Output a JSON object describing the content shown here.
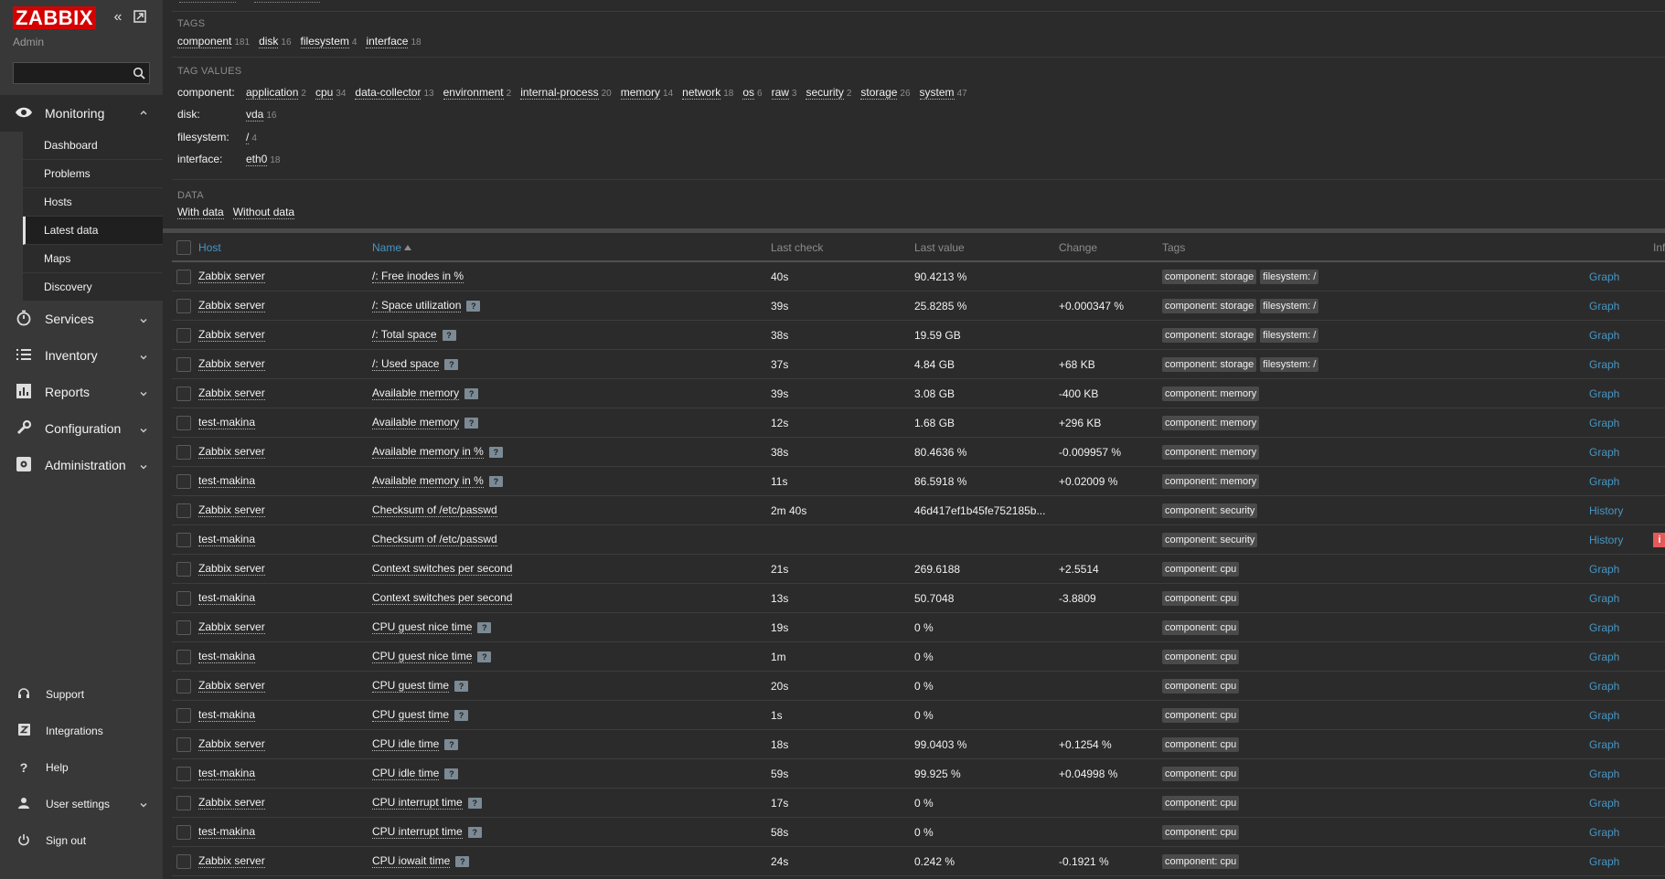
{
  "brand": {
    "logo": "ZABBIX",
    "user": "Admin"
  },
  "sidebar": {
    "search_placeholder": "",
    "monitoring": {
      "label": "Monitoring",
      "items": [
        "Dashboard",
        "Problems",
        "Hosts",
        "Latest data",
        "Maps",
        "Discovery"
      ],
      "active": "Latest data"
    },
    "menus": [
      "Services",
      "Inventory",
      "Reports",
      "Configuration",
      "Administration"
    ],
    "bottom": [
      "Support",
      "Integrations",
      "Help",
      "User settings",
      "Sign out"
    ]
  },
  "filter": {
    "tags_heading": "TAGS",
    "tags": [
      {
        "name": "component",
        "count": "181"
      },
      {
        "name": "disk",
        "count": "16"
      },
      {
        "name": "filesystem",
        "count": "4"
      },
      {
        "name": "interface",
        "count": "18"
      }
    ],
    "tag_values_heading": "TAG VALUES",
    "tag_values": [
      {
        "label": "component:",
        "values": [
          {
            "name": "application",
            "count": "2"
          },
          {
            "name": "cpu",
            "count": "34"
          },
          {
            "name": "data-collector",
            "count": "13"
          },
          {
            "name": "environment",
            "count": "2"
          },
          {
            "name": "internal-process",
            "count": "20"
          },
          {
            "name": "memory",
            "count": "14"
          },
          {
            "name": "network",
            "count": "18"
          },
          {
            "name": "os",
            "count": "6"
          },
          {
            "name": "raw",
            "count": "3"
          },
          {
            "name": "security",
            "count": "2"
          },
          {
            "name": "storage",
            "count": "26"
          },
          {
            "name": "system",
            "count": "47"
          }
        ]
      },
      {
        "label": "disk:",
        "values": [
          {
            "name": "vda",
            "count": "16"
          }
        ]
      },
      {
        "label": "filesystem:",
        "values": [
          {
            "name": "/",
            "count": "4"
          }
        ]
      },
      {
        "label": "interface:",
        "values": [
          {
            "name": "eth0",
            "count": "18"
          }
        ]
      }
    ],
    "data_heading": "DATA",
    "data_links": [
      "With data",
      "Without data"
    ]
  },
  "table": {
    "headers": {
      "host": "Host",
      "name": "Name",
      "last_check": "Last check",
      "last_value": "Last value",
      "change": "Change",
      "tags": "Tags",
      "info": "Info"
    },
    "rows": [
      {
        "host": "Zabbix server",
        "name": "/: Free inodes in %",
        "hint": false,
        "check": "40s",
        "value": "90.4213 %",
        "change": "",
        "tags": [
          "component: storage",
          "filesystem: /"
        ],
        "action": "Graph",
        "info": false
      },
      {
        "host": "Zabbix server",
        "name": "/: Space utilization",
        "hint": true,
        "check": "39s",
        "value": "25.8285 %",
        "change": "+0.000347 %",
        "tags": [
          "component: storage",
          "filesystem: /"
        ],
        "action": "Graph",
        "info": false
      },
      {
        "host": "Zabbix server",
        "name": "/: Total space",
        "hint": true,
        "check": "38s",
        "value": "19.59 GB",
        "change": "",
        "tags": [
          "component: storage",
          "filesystem: /"
        ],
        "action": "Graph",
        "info": false
      },
      {
        "host": "Zabbix server",
        "name": "/: Used space",
        "hint": true,
        "check": "37s",
        "value": "4.84 GB",
        "change": "+68 KB",
        "tags": [
          "component: storage",
          "filesystem: /"
        ],
        "action": "Graph",
        "info": false
      },
      {
        "host": "Zabbix server",
        "name": "Available memory",
        "hint": true,
        "check": "39s",
        "value": "3.08 GB",
        "change": "-400 KB",
        "tags": [
          "component: memory"
        ],
        "action": "Graph",
        "info": false
      },
      {
        "host": "test-makina",
        "name": "Available memory",
        "hint": true,
        "check": "12s",
        "value": "1.68 GB",
        "change": "+296 KB",
        "tags": [
          "component: memory"
        ],
        "action": "Graph",
        "info": false
      },
      {
        "host": "Zabbix server",
        "name": "Available memory in %",
        "hint": true,
        "check": "38s",
        "value": "80.4636 %",
        "change": "-0.009957 %",
        "tags": [
          "component: memory"
        ],
        "action": "Graph",
        "info": false
      },
      {
        "host": "test-makina",
        "name": "Available memory in %",
        "hint": true,
        "check": "11s",
        "value": "86.5918 %",
        "change": "+0.02009 %",
        "tags": [
          "component: memory"
        ],
        "action": "Graph",
        "info": false
      },
      {
        "host": "Zabbix server",
        "name": "Checksum of /etc/passwd",
        "hint": false,
        "check": "2m 40s",
        "value": "46d417ef1b45fe752185b...",
        "change": "",
        "tags": [
          "component: security"
        ],
        "action": "History",
        "info": false
      },
      {
        "host": "test-makina",
        "name": "Checksum of /etc/passwd",
        "hint": false,
        "check": "",
        "value": "",
        "change": "",
        "tags": [
          "component: security"
        ],
        "action": "History",
        "info": true
      },
      {
        "host": "Zabbix server",
        "name": "Context switches per second",
        "hint": false,
        "check": "21s",
        "value": "269.6188",
        "change": "+2.5514",
        "tags": [
          "component: cpu"
        ],
        "action": "Graph",
        "info": false
      },
      {
        "host": "test-makina",
        "name": "Context switches per second",
        "hint": false,
        "check": "13s",
        "value": "50.7048",
        "change": "-3.8809",
        "tags": [
          "component: cpu"
        ],
        "action": "Graph",
        "info": false
      },
      {
        "host": "Zabbix server",
        "name": "CPU guest nice time",
        "hint": true,
        "check": "19s",
        "value": "0 %",
        "change": "",
        "tags": [
          "component: cpu"
        ],
        "action": "Graph",
        "info": false
      },
      {
        "host": "test-makina",
        "name": "CPU guest nice time",
        "hint": true,
        "check": "1m",
        "value": "0 %",
        "change": "",
        "tags": [
          "component: cpu"
        ],
        "action": "Graph",
        "info": false
      },
      {
        "host": "Zabbix server",
        "name": "CPU guest time",
        "hint": true,
        "check": "20s",
        "value": "0 %",
        "change": "",
        "tags": [
          "component: cpu"
        ],
        "action": "Graph",
        "info": false
      },
      {
        "host": "test-makina",
        "name": "CPU guest time",
        "hint": true,
        "check": "1s",
        "value": "0 %",
        "change": "",
        "tags": [
          "component: cpu"
        ],
        "action": "Graph",
        "info": false
      },
      {
        "host": "Zabbix server",
        "name": "CPU idle time",
        "hint": true,
        "check": "18s",
        "value": "99.0403 %",
        "change": "+0.1254 %",
        "tags": [
          "component: cpu"
        ],
        "action": "Graph",
        "info": false
      },
      {
        "host": "test-makina",
        "name": "CPU idle time",
        "hint": true,
        "check": "59s",
        "value": "99.925 %",
        "change": "+0.04998 %",
        "tags": [
          "component: cpu"
        ],
        "action": "Graph",
        "info": false
      },
      {
        "host": "Zabbix server",
        "name": "CPU interrupt time",
        "hint": true,
        "check": "17s",
        "value": "0 %",
        "change": "",
        "tags": [
          "component: cpu"
        ],
        "action": "Graph",
        "info": false
      },
      {
        "host": "test-makina",
        "name": "CPU interrupt time",
        "hint": true,
        "check": "58s",
        "value": "0 %",
        "change": "",
        "tags": [
          "component: cpu"
        ],
        "action": "Graph",
        "info": false
      },
      {
        "host": "Zabbix server",
        "name": "CPU iowait time",
        "hint": true,
        "check": "24s",
        "value": "0.242 %",
        "change": "-0.1921 %",
        "tags": [
          "component: cpu"
        ],
        "action": "Graph",
        "info": false
      }
    ]
  },
  "colors": {
    "link": "#4796c4",
    "brand_red": "#d40000",
    "info_red": "#e45959"
  },
  "icons": {
    "hint": "?",
    "info": "i"
  }
}
